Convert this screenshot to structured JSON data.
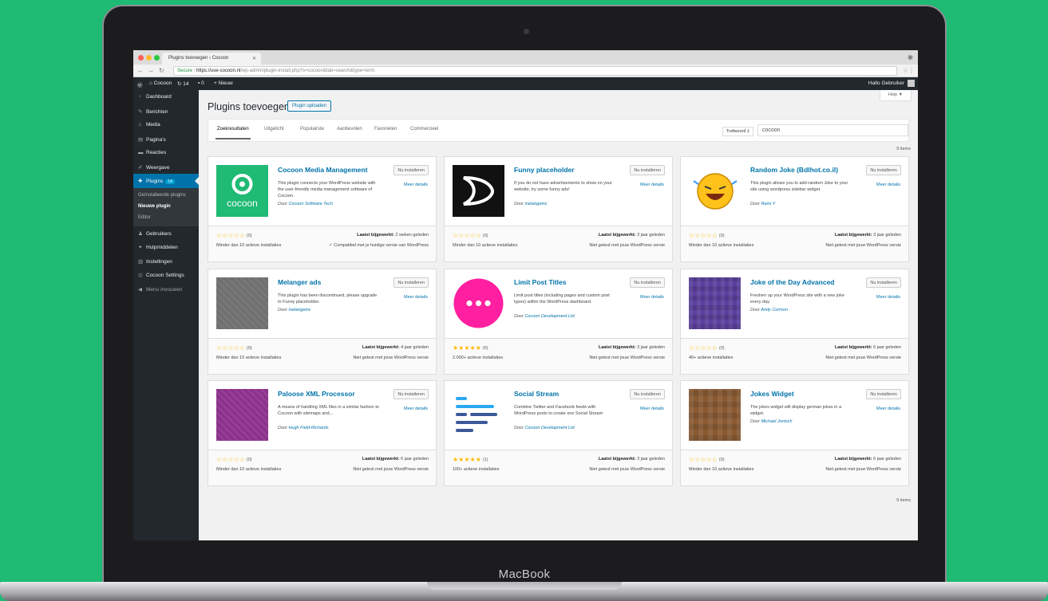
{
  "device": {
    "label": "MacBook"
  },
  "browser": {
    "tab_title": "Plugins toevoegen ‹ Cocoon",
    "url_secure": "Secure",
    "url_host": "https://use-cocoon.nl",
    "url_path": "/wp-admin/plugin-install.php?s=cocoon&tab=search&type=term"
  },
  "adminbar": {
    "site": "Cocoon",
    "updates": "14",
    "comments": "0",
    "new": "Nieuw",
    "greeting": "Hallo Gebruiker"
  },
  "sidebar": {
    "items": [
      {
        "label": "Dashboard",
        "icon": "◔"
      },
      {
        "label": "Berichten",
        "icon": "✎"
      },
      {
        "label": "Media",
        "icon": "♫"
      },
      {
        "label": "Pagina's",
        "icon": "▤"
      },
      {
        "label": "Reacties",
        "icon": "▬"
      },
      {
        "label": "Weergave",
        "icon": "✐"
      },
      {
        "label": "Plugins",
        "icon": "✚",
        "badge": "14"
      }
    ],
    "submenu": [
      "Geïnstalleerde plugins",
      "Nieuwe plugin",
      "Editor"
    ],
    "items_after": [
      {
        "label": "Gebruikers",
        "icon": "♟"
      },
      {
        "label": "Hulpmiddelen",
        "icon": "✦"
      },
      {
        "label": "Instellingen",
        "icon": "▥"
      },
      {
        "label": "Cocoon Settings",
        "icon": "◎"
      }
    ],
    "collapse": "Menu invouwen"
  },
  "main": {
    "title": "Plugins toevoegen",
    "upload_button": "Plugin uploaden",
    "help": "Help ▼",
    "tabs": [
      "Zoekresultaten",
      "Uitgelicht",
      "Populairste",
      "Aanbevolen",
      "Favorieten",
      "Commercieel"
    ],
    "search_type": "Trefwoord ‡",
    "search_value": "cocoon",
    "item_count": "9 items"
  },
  "colors": {
    "accent": "#0073aa",
    "sidebar": "#23282d",
    "star": "#ffb900",
    "cocoon_green": "#1fba74"
  },
  "plugins": [
    {
      "name": "Cocoon Media Management",
      "install": "Nu installeren",
      "details": "Meer details",
      "desc": "This plugin connects your WordPress website with the user-friendly media management software of Cocoon.",
      "author_prefix": "Door ",
      "author": "Cocoon Software Tech",
      "stars": "☆☆☆☆☆",
      "rating_count": "(0)",
      "updated_label": "Laatst bijgewerkt:",
      "updated": "2 weken geleden",
      "installs": "Minder dan 10 actieve installaties",
      "compat": "✓ Compatibel met je huidige versie van WordPress",
      "icon": "cocoon-logo",
      "icon_text": "cocoon"
    },
    {
      "name": "Funny placeholder",
      "install": "Nu installeren",
      "details": "Meer details",
      "desc": "If you do not have advertisements to show on your website, try some funny ads!",
      "author_prefix": "Door ",
      "author": "melangeinc",
      "stars": "☆☆☆☆☆",
      "rating_count": "(0)",
      "updated_label": "Laatst bijgewerkt:",
      "updated": "3 jaar geleden",
      "installs": "Minder dan 10 actieve installaties",
      "compat": "Niet getest met jouw WordPress versie",
      "icon": "funny-placeholder-logo"
    },
    {
      "name": "Random Joke (Bdlhot.co.il)",
      "install": "Nu installeren",
      "details": "Meer details",
      "desc": "This plugin allows you to add random Joke to your site using wordpress sidebar widget.",
      "author_prefix": "Door ",
      "author": "Rami Y",
      "stars": "☆☆☆☆☆",
      "rating_count": "(0)",
      "updated_label": "Laatst bijgewerkt:",
      "updated": "3 jaar geleden",
      "installs": "Minder dan 10 actieve installaties",
      "compat": "Niet getest met jouw WordPress versie",
      "icon": "laughing-smiley-icon"
    },
    {
      "name": "Melanger ads",
      "install": "Nu installeren",
      "details": "Meer details",
      "desc": "This plugin has been discontinued, please upgrade to Funny placeholder.",
      "author_prefix": "Door ",
      "author": "melangeinc",
      "stars": "☆☆☆☆☆",
      "rating_count": "(0)",
      "updated_label": "Laatst bijgewerkt:",
      "updated": "4 jaar geleden",
      "installs": "Minder dan 10 actieve installaties",
      "compat": "Niet getest met jouw WordPress versie",
      "icon": "gray-pattern-icon"
    },
    {
      "name": "Limit Post Titles",
      "install": "Nu installeren",
      "details": "Meer details",
      "desc": "Limit post titles (including pages and custom post types) within the WordPress dashboard.",
      "author_prefix": "Door ",
      "author": "Cocoon Development Ltd",
      "stars": "★★★★★",
      "rating_count": "(6)",
      "updated_label": "Laatst bijgewerkt:",
      "updated": "3 jaar geleden",
      "installs": "2.000+ actieve installaties",
      "compat": "Niet getest met jouw WordPress versie",
      "icon": "pink-dots-icon"
    },
    {
      "name": "Joke of the Day Advanced",
      "install": "Nu installeren",
      "details": "Meer details",
      "desc": "Freshen up your WordPress site with a new joke every day.",
      "author_prefix": "Door ",
      "author": "Andy Cormon",
      "stars": "☆☆☆☆☆",
      "rating_count": "(0)",
      "updated_label": "Laatst bijgewerkt:",
      "updated": "6 jaar geleden",
      "installs": "40+ actieve installaties",
      "compat": "Niet getest met jouw WordPress versie",
      "icon": "purple-pattern-icon"
    },
    {
      "name": "Paloose XML Processor",
      "install": "Nu installeren",
      "details": "Meer details",
      "desc": "A means of handling XML files in a similar fashion to Cocoon with sitemaps and...",
      "author_prefix": "Door ",
      "author": "Hugh Field-Richards",
      "stars": "☆☆☆☆☆",
      "rating_count": "(0)",
      "updated_label": "Laatst bijgewerkt:",
      "updated": "6 jaar geleden",
      "installs": "Minder dan 10 actieve installaties",
      "compat": "Niet getest met jouw WordPress versie",
      "icon": "magenta-pattern-icon"
    },
    {
      "name": "Social Stream",
      "install": "Nu installeren",
      "details": "Meer details",
      "desc": "Combine Twitter and Facebook feeds with WordPress posts to create one Social Stream",
      "author_prefix": "Door ",
      "author": "Cocoon Development Ltd",
      "stars": "★★★★★",
      "rating_count": "(1)",
      "updated_label": "Laatst bijgewerkt:",
      "updated": "3 jaar geleden",
      "installs": "100+ actieve installaties",
      "compat": "Niet getest met jouw WordPress versie",
      "icon": "stream-lines-icon"
    },
    {
      "name": "Jokes Widget",
      "install": "Nu installeren",
      "details": "Meer details",
      "desc": "The jokes widget will display german jokes in a widget.",
      "author_prefix": "Door ",
      "author": "Michael Jonisch",
      "stars": "☆☆☆☆☆",
      "rating_count": "(0)",
      "updated_label": "Laatst bijgewerkt:",
      "updated": "6 jaar geleden",
      "installs": "Minder dan 10 actieve installaties",
      "compat": "Niet getest met jouw WordPress versie",
      "icon": "brown-pattern-icon"
    }
  ]
}
